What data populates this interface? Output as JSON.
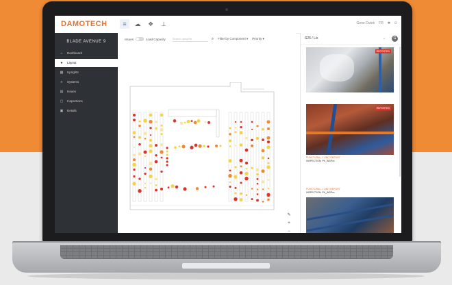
{
  "app": {
    "logo": "DAMOTECH",
    "user_name": "Gene Dutek",
    "language": "FR"
  },
  "sidebar": {
    "site_name": "BLADE AVENUE 9",
    "items": [
      {
        "label": "Dashboard",
        "icon": "home-icon",
        "glyph": "⌂"
      },
      {
        "label": "Layout",
        "icon": "map-pin-icon",
        "glyph": "●"
      },
      {
        "label": "Uprights",
        "icon": "grid-icon",
        "glyph": "▦"
      },
      {
        "label": "Systems",
        "icon": "list-icon",
        "glyph": "≡"
      },
      {
        "label": "Issues",
        "icon": "flag-icon",
        "glyph": "▤"
      },
      {
        "label": "Inspections",
        "icon": "clipboard-icon",
        "glyph": "▢"
      },
      {
        "label": "Details",
        "icon": "bookmark-icon",
        "glyph": "▣"
      }
    ]
  },
  "toolbar": {
    "issues_label": "Issues",
    "load_capacity_label": "Load Capacity",
    "search_placeholder": "Search uprights",
    "filter_label": "Filter by Component ▾",
    "priority_label": "Priority ▾"
  },
  "panel": {
    "title": "S25 / Lix",
    "photos": [
      {
        "badge": "REPORTED",
        "caption_line1": "",
        "caption_line2": "",
        "caption_line3": ""
      },
      {
        "badge": "REPORTED",
        "caption_line1": "PUNCTURAL, 1 UNIT REPORT",
        "caption_line2": "INSPECTION: PK_INSPxx",
        "caption_line3": ""
      },
      {
        "badge": "",
        "caption_line1": "PUNCTURAL, 1 UNIT REPORT",
        "caption_line2": "INSPECTION: PK_INSPxx",
        "caption_line3": ""
      }
    ]
  },
  "colors": {
    "brand_orange": "#ef8a35",
    "sidebar_bg": "#2e3135",
    "issue_red": "#d9342b",
    "issue_yellow": "#f2d44a",
    "issue_orange": "#ee8a32"
  }
}
